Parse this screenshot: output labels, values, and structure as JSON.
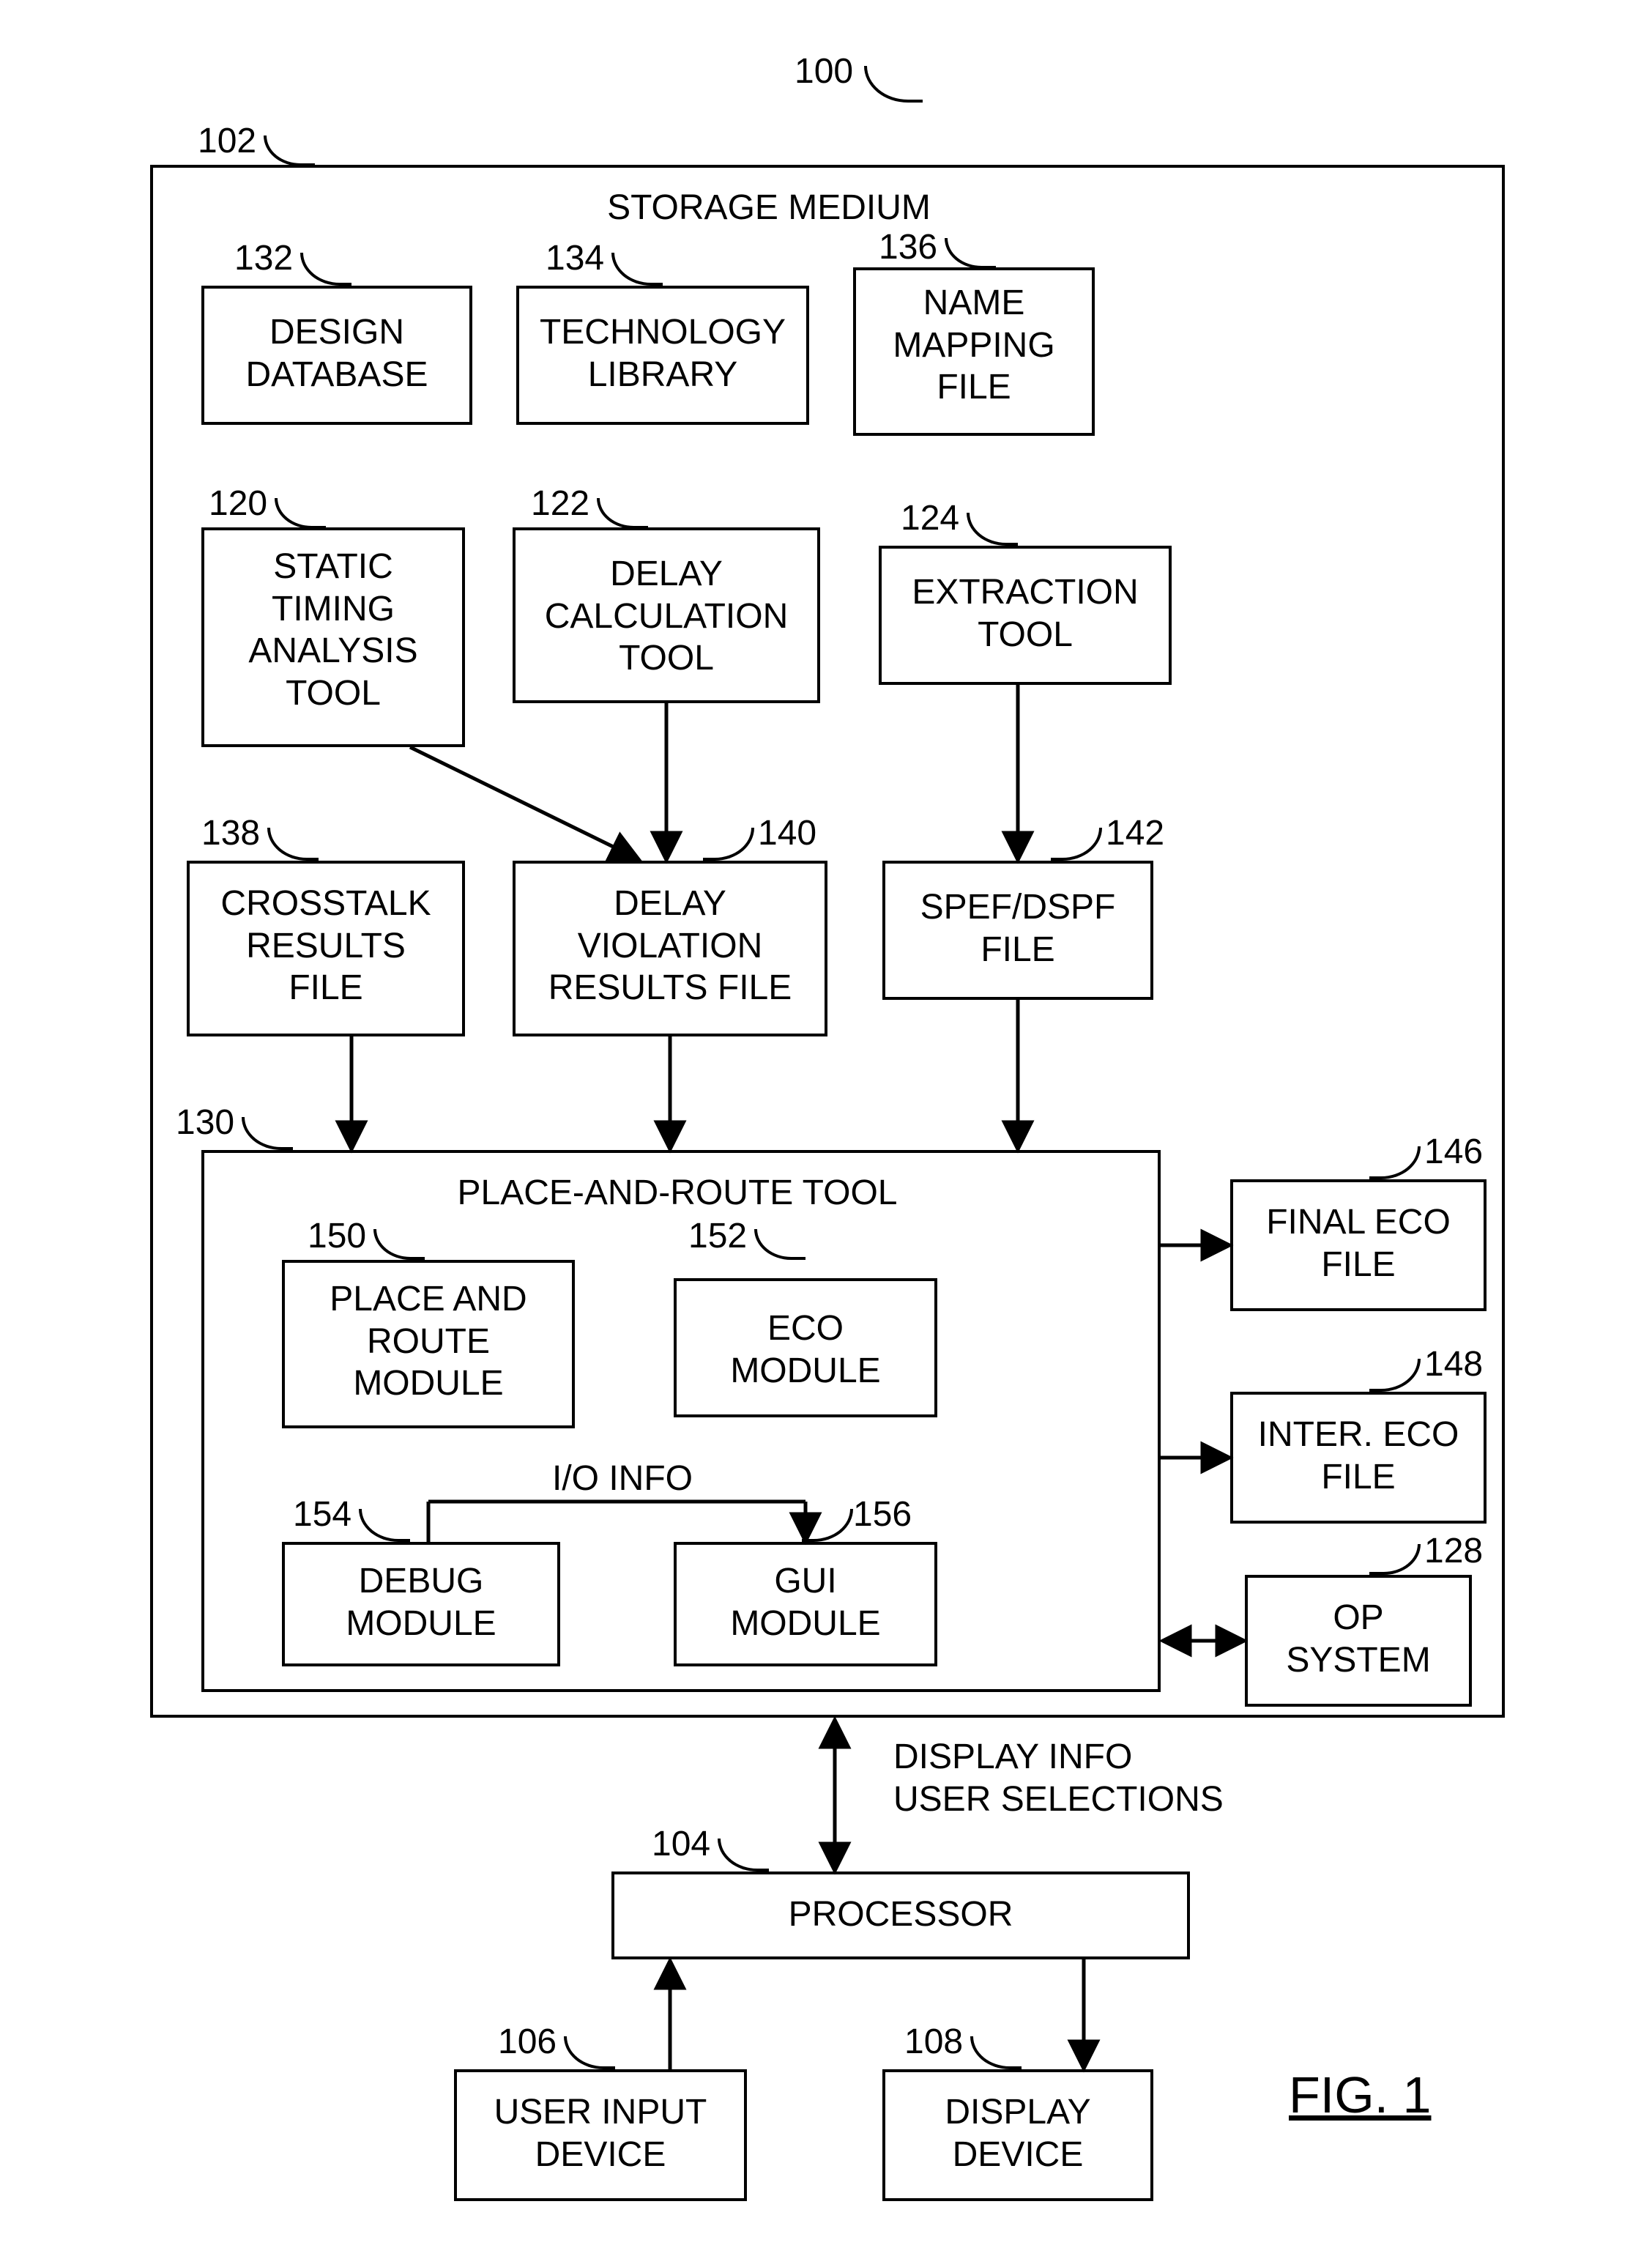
{
  "figure": {
    "id_100": "100",
    "label_fig1": "FIG. 1"
  },
  "storage_medium": {
    "ref": "102",
    "title": "STORAGE MEDIUM",
    "design_database": {
      "ref": "132",
      "label": "DESIGN\nDATABASE"
    },
    "technology_library": {
      "ref": "134",
      "label": "TECHNOLOGY\nLIBRARY"
    },
    "name_mapping_file": {
      "ref": "136",
      "label": "NAME\nMAPPING\nFILE"
    },
    "static_timing_tool": {
      "ref": "120",
      "label": "STATIC\nTIMING\nANALYSIS\nTOOL"
    },
    "delay_calc_tool": {
      "ref": "122",
      "label": "DELAY\nCALCULATION\nTOOL"
    },
    "extraction_tool": {
      "ref": "124",
      "label": "EXTRACTION\nTOOL"
    },
    "crosstalk_results": {
      "ref": "138",
      "label": "CROSSTALK\nRESULTS\nFILE"
    },
    "delay_violation_results": {
      "ref": "140",
      "label": "DELAY\nVIOLATION\nRESULTS FILE"
    },
    "spef_dspf_file": {
      "ref": "142",
      "label": "SPEF/DSPF\nFILE"
    },
    "place_route_tool": {
      "ref": "130",
      "title": "PLACE-AND-ROUTE TOOL",
      "place_route_module": {
        "ref": "150",
        "label": "PLACE AND\nROUTE\nMODULE"
      },
      "eco_module": {
        "ref": "152",
        "label": "ECO\nMODULE"
      },
      "io_info_label": "I/O INFO",
      "debug_module": {
        "ref": "154",
        "label": "DEBUG\nMODULE"
      },
      "gui_module": {
        "ref": "156",
        "label": "GUI\nMODULE"
      }
    },
    "final_eco_file": {
      "ref": "146",
      "label": "FINAL ECO\nFILE"
    },
    "inter_eco_file": {
      "ref": "148",
      "label": "INTER. ECO\nFILE"
    },
    "op_system": {
      "ref": "128",
      "label": "OP\nSYSTEM"
    }
  },
  "display_info_label": "DISPLAY INFO\nUSER SELECTIONS",
  "processor": {
    "ref": "104",
    "label": "PROCESSOR"
  },
  "user_input_device": {
    "ref": "106",
    "label": "USER INPUT\nDEVICE"
  },
  "display_device": {
    "ref": "108",
    "label": "DISPLAY\nDEVICE"
  }
}
